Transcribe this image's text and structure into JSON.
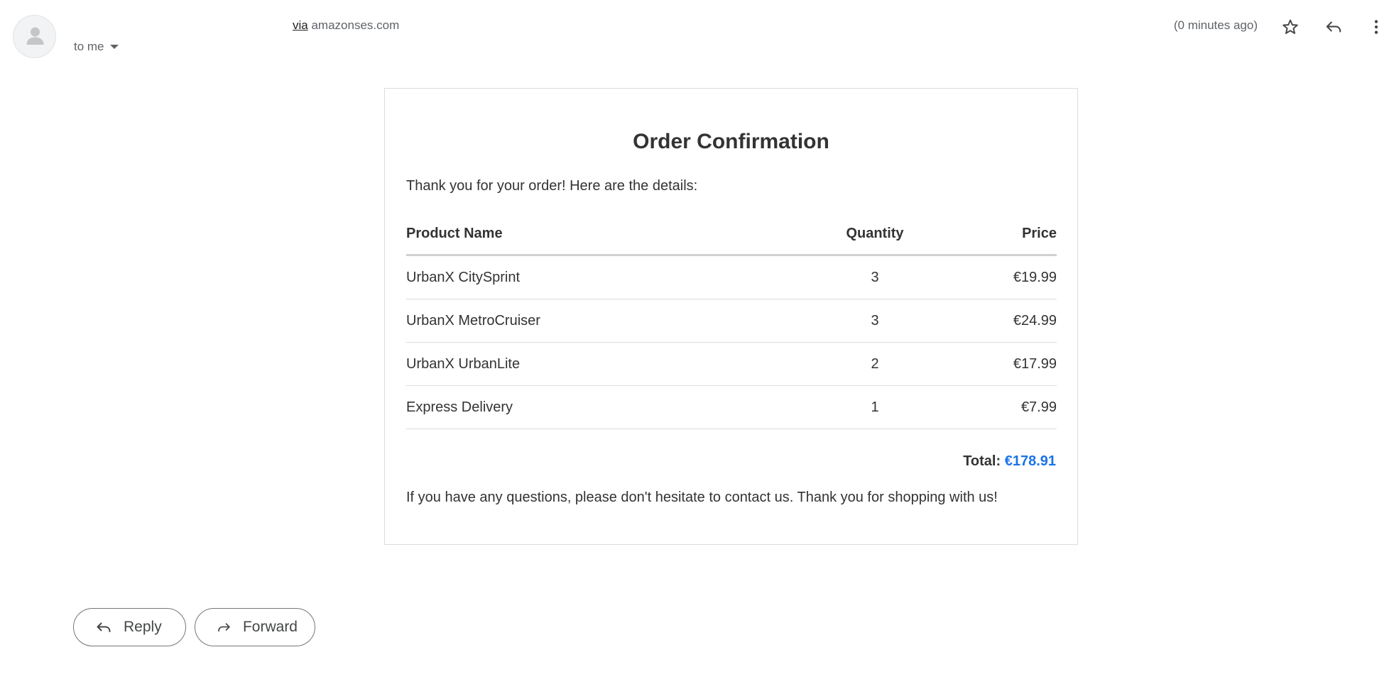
{
  "header": {
    "recipient_label": "to me",
    "via_label": "via",
    "via_domain": "amazonses.com",
    "timestamp": "(0 minutes ago)"
  },
  "icons": {
    "avatar": "person-icon",
    "star": "star-icon",
    "reply": "reply-icon",
    "more": "more-vertical-icon",
    "dropdown": "caret-down-icon",
    "forward": "forward-icon"
  },
  "email": {
    "title": "Order Confirmation",
    "intro": "Thank you for your order! Here are the details:",
    "table": {
      "headers": {
        "product": "Product Name",
        "quantity": "Quantity",
        "price": "Price"
      },
      "rows": [
        {
          "product": "UrbanX CitySprint",
          "quantity": "3",
          "price": "€19.99"
        },
        {
          "product": "UrbanX MetroCruiser",
          "quantity": "3",
          "price": "€24.99"
        },
        {
          "product": "UrbanX UrbanLite",
          "quantity": "2",
          "price": "€17.99"
        },
        {
          "product": "Express Delivery",
          "quantity": "1",
          "price": "€7.99"
        }
      ]
    },
    "total_label": "Total:",
    "total_value": "€178.91",
    "closing": "If you have any questions, please don't hesitate to contact us. Thank you for shopping with us!"
  },
  "actions": {
    "reply_label": "Reply",
    "forward_label": "Forward"
  },
  "colors": {
    "total_accent": "#1a73e8",
    "muted_text": "#5f6368",
    "body_text": "#333333"
  }
}
